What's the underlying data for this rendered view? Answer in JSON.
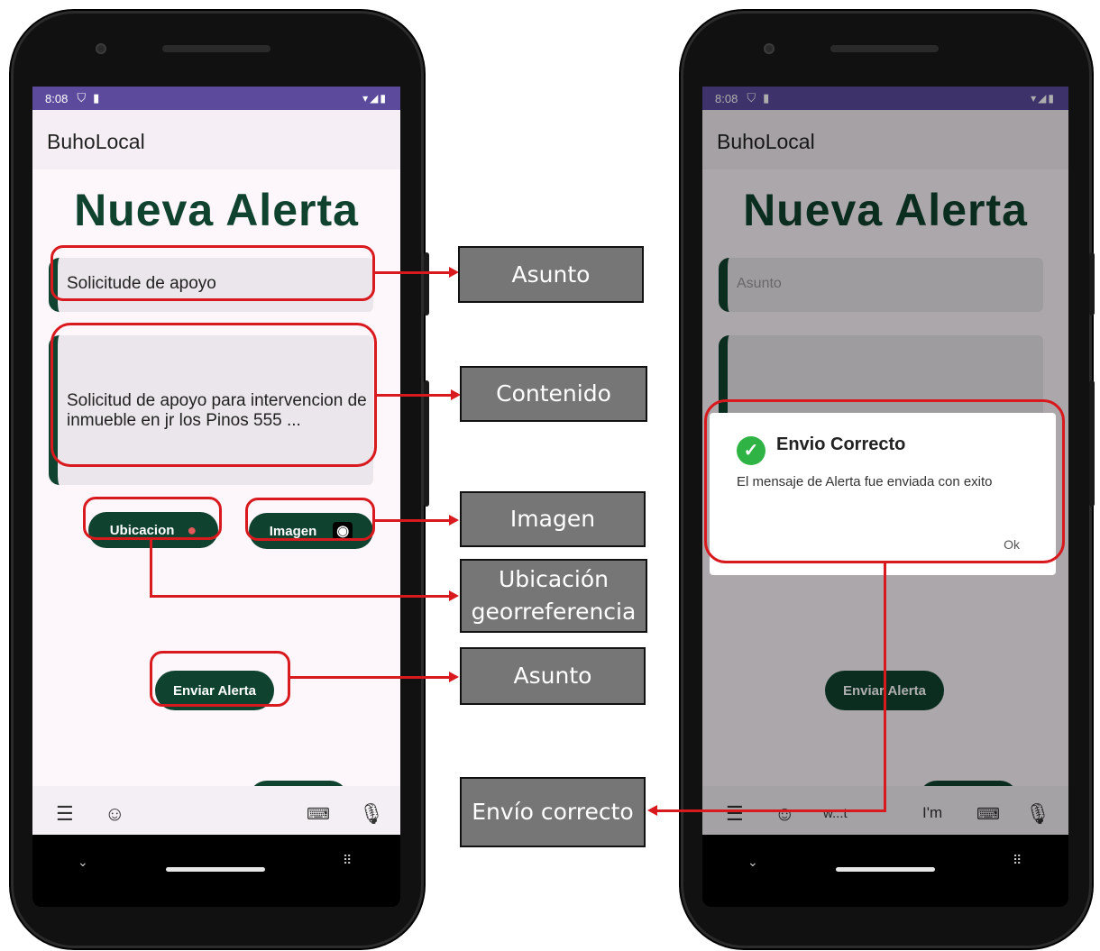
{
  "left_phone": {
    "status_time": "8:08",
    "status_icons": "▾◢▮",
    "app_title": "BuhoLocal",
    "heading": "Nueva Alerta",
    "subject_value": "Solicitude de apoyo",
    "content_value": "Solicitud de apoyo para intervencion de inmueble en jr los Pinos 555 ...",
    "location_button": "Ubicacion",
    "image_button": "Imagen",
    "send_button": "Enviar Alerta"
  },
  "right_phone": {
    "status_time": "8:08",
    "status_icons": "▾◢▮",
    "app_title": "BuhoLocal",
    "heading": "Nueva Alerta",
    "subject_placeholder": "Asunto",
    "send_button": "Enviar Alerta",
    "keyboard_suggestion_1": "w...t",
    "keyboard_suggestion_2": "I'm",
    "dialog": {
      "title": "Envio Correcto",
      "message": "El mensaje de Alerta fue enviada con exito",
      "ok": "Ok"
    }
  },
  "annotations": {
    "asunto": "Asunto",
    "contenido": "Contenido",
    "imagen": "Imagen",
    "ubicacion_1": "Ubicación",
    "ubicacion_2": "georreferencia",
    "enviar": "Asunto",
    "envio_correcto": "Envío correcto"
  },
  "colors": {
    "accent_green": "#10432f",
    "status_bar": "#5c4a9c",
    "highlight_red": "#d81a1f",
    "label_gray": "#767676",
    "success_green": "#2fb344"
  }
}
